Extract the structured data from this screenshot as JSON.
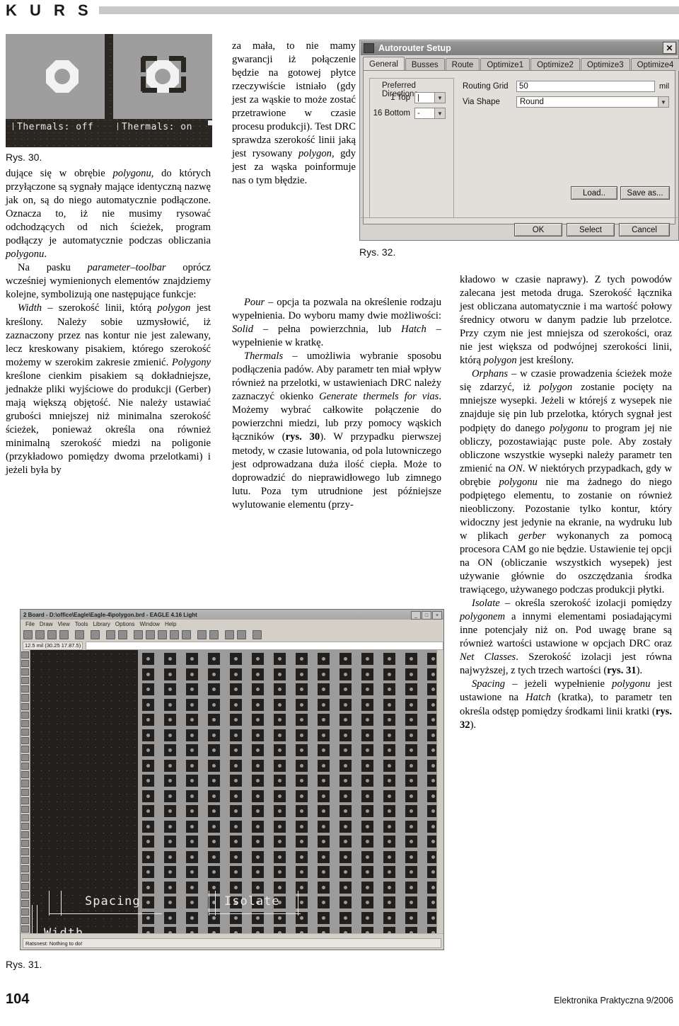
{
  "masthead": {
    "section": "K U R S"
  },
  "figure30": {
    "caption": "Rys. 30.",
    "label_left": "Thermals: off",
    "label_right": "Thermals: on"
  },
  "figure31": {
    "caption": "Rys. 31.",
    "window": {
      "title": "2 Board - D:\\office\\Eagle\\Eagle-4\\polygon.brd - EAGLE 4.16 Light",
      "minimize": "_",
      "maximize": "□",
      "close": "×",
      "menu": [
        "File",
        "Draw",
        "View",
        "Tools",
        "Library",
        "Options",
        "Window",
        "Help"
      ],
      "coord_value": "12.5 mil (30.25 17.87.5)",
      "status": "Ratsnest: Nothing to do!",
      "dim_labels": [
        "Spacing",
        "Isolate",
        "Width"
      ]
    }
  },
  "figure32": {
    "caption": "Rys. 32.",
    "dialog": {
      "title": "Autorouter Setup",
      "close_glyph": "✕",
      "tabs": [
        {
          "label": "General",
          "active": true
        },
        {
          "label": "Busses",
          "active": false
        },
        {
          "label": "Route",
          "active": false
        },
        {
          "label": "Optimize1",
          "active": false
        },
        {
          "label": "Optimize2",
          "active": false
        },
        {
          "label": "Optimize3",
          "active": false
        },
        {
          "label": "Optimize4",
          "active": false
        }
      ],
      "group_preferred_directions": "Preferred Directions",
      "layer_rows": [
        {
          "label": "1 Top",
          "value": "|"
        },
        {
          "label": "16 Bottom",
          "value": "-"
        }
      ],
      "routing_grid_label": "Routing Grid",
      "routing_grid_value": "50",
      "routing_grid_unit": "mil",
      "via_shape_label": "Via Shape",
      "via_shape_value": "Round",
      "buttons": {
        "load": "Load..",
        "save_as": "Save as...",
        "ok": "OK",
        "select": "Select",
        "cancel": "Cancel"
      },
      "dropdown_glyph": "▼"
    }
  },
  "column1": {
    "p1": "dujące się w obrębie <i>polygonu</i>, do których przyłączone są sygnały mające identyczną nazwę jak on, są do niego automatycznie podłączone. Oznacza to, iż nie musimy rysować odchodzących od nich ścieżek, program podłączy je automatycznie podczas obliczania <i>polygonu</i>.",
    "p2": "Na pasku <i>parameter&#8211;toolbar</i> oprócz wcześniej wymienionych elementów znajdziemy kolejne, symbolizują one następujące funkcje:",
    "p3": "<i>Width</i> &#8211; szerokość linii, którą <i>polygon</i> jest kreślony. Należy sobie uzmysłowić, iż zaznaczony przez nas kontur nie jest zalewany, lecz kreskowany pisakiem, którego szerokość możemy w szerokim zakresie zmienić. <i>Polygony</i> kreślone cienkim pisakiem są dokładniejsze, jednakże pliki wyjściowe do produkcji (Gerber) mają większą objętość. Nie należy ustawiać grubości mniejszej niż minimalna szerokość ścieżek, ponieważ określa ona również minimalną szerokość miedzi na poligonie (przykładowo pomiędzy dwoma przelotkami) i jeżeli była by"
  },
  "column2": {
    "p1": "za mała, to nie mamy gwarancji iż połączenie będzie na gotowej płytce rzeczywiście istniało (gdy jest za wąskie to może zostać przetrawione w czasie procesu produkcji). Test DRC sprawdza szerokość linii jaką jest rysowany <i>polygon</i>, gdy jest za wąska poinformuje nas o tym błędzie.",
    "p2": "<i>Pour</i> &#8211; opcja ta pozwala na określenie rodzaju wypełnienia. Do wyboru mamy dwie możliwości: <i>Solid</i> &#8211; pełna powierzchnia, lub <i>Hatch</i> &#8211; wypełnienie w kratkę.",
    "p3": "<i>Thermals</i> &#8211; umożliwia wybranie sposobu podłączenia padów. Aby parametr ten miał wpływ również na przelotki, w ustawieniach DRC należy zaznaczyć okienko <i>Generate thermels for vias</i>. Możemy wybrać całkowite połączenie do powierzchni miedzi, lub przy pomocy wąskich łączników (<b>rys. 30</b>). W przypadku pierwszej metody, w czasie lutowania, od pola lutowniczego jest odprowadzana duża ilość ciepła. Może to doprowadzić do nieprawidłowego lub zimnego lutu. Poza tym utrudnione jest późniejsze wylutowanie elementu (przy-"
  },
  "column3": {
    "p1": "kładowo w czasie naprawy). Z tych powodów zalecana jest metoda druga. Szerokość łącznika jest obliczana automatycznie i ma wartość połowy średnicy otworu w danym padzie lub przelotce. Przy czym nie jest mniejsza od szerokości, oraz nie jest większa od podwójnej szerokości linii, którą <i>polygon</i> jest kreślony.",
    "p2": "<i>Orphans</i> &#8211; w czasie prowadzenia ścieżek może się zdarzyć, iż <i>polygon</i> zostanie pocięty na mniejsze wysepki. Jeżeli w którejś z wysepek nie znajduje się pin lub przelotka, których sygnał jest podpięty do danego <i>polygonu</i> to program jej nie obliczy, pozostawiając puste pole. Aby zostały obliczone wszystkie wysepki należy parametr ten zmienić na <i>ON</i>. W niektórych przypadkach, gdy w obrębie <i>polygonu</i> nie ma żadnego do niego podpiętego elementu, to zostanie on również nieobliczony. Pozostanie tylko kontur, który widoczny jest jedynie na ekranie, na wydruku lub w plikach <i>gerber</i> wykonanych za pomocą procesora CAM go nie będzie. Ustawienie tej opcji na ON (obliczanie wszystkich wysepek) jest używanie głównie do oszczędzania środka trawiącego, używanego podczas produkcji płytki.",
    "p3": "<i>Isolate</i> &#8211; określa szerokość izolacji pomiędzy <i>polygonem</i> a innymi elementami posiadającymi inne potencjały niż on. Pod uwagę brane są również wartości ustawione w opcjach DRC oraz <i>Net Classes</i>. Szerokość izolacji jest równa najwyższej, z tych trzech wartości (<b>rys. 31</b>).",
    "p4": "<i>Spacing</i> &#8211; jeżeli wypełnienie <i>polygonu</i> jest ustawione na <i>Hatch</i> (kratka), to parametr ten określa odstęp pomiędzy środkami linii kratki (<b>rys. 32</b>)."
  },
  "footer": {
    "page_number": "104",
    "magazine": "Elektronika Praktyczna 9/2006"
  }
}
